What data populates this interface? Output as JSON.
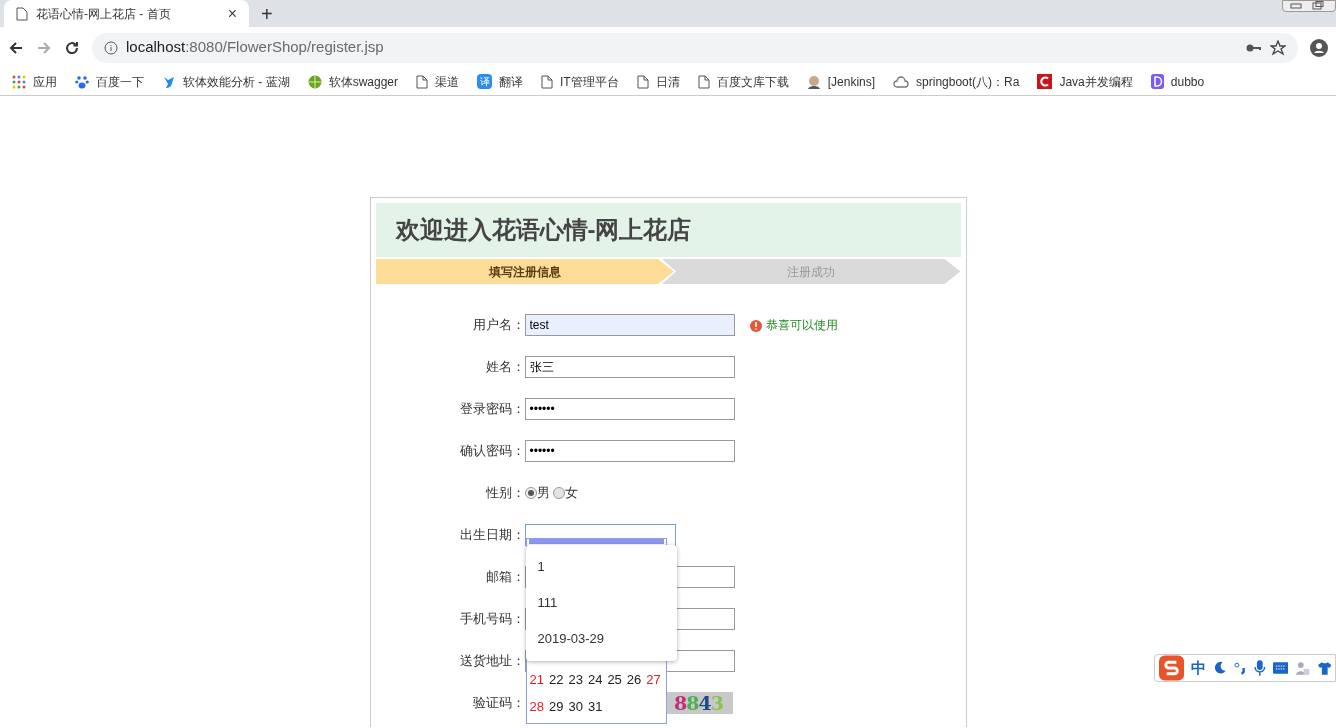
{
  "browser": {
    "tab": {
      "title": "花语心情-网上花店 - 首页",
      "close": "×"
    },
    "new_tab": "+",
    "url": {
      "host": "localhost",
      "path": ":8080/FlowerShop/register.jsp"
    },
    "bookmarks": [
      {
        "kind": "apps",
        "label": "应用"
      },
      {
        "kind": "paw",
        "label": "百度一下"
      },
      {
        "kind": "bird",
        "label": "软体效能分析 - 蓝湖"
      },
      {
        "kind": "globe",
        "label": "软体swagger"
      },
      {
        "kind": "page",
        "label": "渠道"
      },
      {
        "kind": "translate",
        "label": "翻译",
        "glyph": "译"
      },
      {
        "kind": "page",
        "label": "IT管理平台"
      },
      {
        "kind": "page",
        "label": "日清"
      },
      {
        "kind": "page",
        "label": "百度文库下载"
      },
      {
        "kind": "avatar",
        "label": "[Jenkins]"
      },
      {
        "kind": "cloud",
        "label": "springboot(八)：Ra"
      },
      {
        "kind": "c",
        "label": "Java并发编程"
      },
      {
        "kind": "d",
        "label": "dubbo"
      }
    ]
  },
  "page": {
    "title": "欢迎进入花语心情-网上花店",
    "steps": [
      {
        "label": "填写注册信息",
        "selected": true
      },
      {
        "label": "注册成功",
        "selected": false
      }
    ],
    "fields": [
      {
        "kind": "text",
        "label": "用户名：",
        "value": "test",
        "autofilled": true,
        "hint": "恭喜可以使用"
      },
      {
        "kind": "text",
        "label": "姓名：",
        "value": "张三",
        "autofilled": false
      },
      {
        "kind": "password",
        "label": "登录密码：",
        "value": "••••••",
        "autofilled": false
      },
      {
        "kind": "password",
        "label": "确认密码：",
        "value": "••••••",
        "autofilled": false
      },
      {
        "kind": "radio",
        "label": "性别：",
        "options": [
          {
            "label": "男",
            "selected": true
          },
          {
            "label": "女",
            "selected": false
          }
        ]
      },
      {
        "kind": "date",
        "label": "出生日期：",
        "focused": true
      },
      {
        "kind": "text",
        "label": "邮箱：",
        "autofilled": false
      },
      {
        "kind": "text",
        "label": "手机号码：",
        "autofilled": false
      },
      {
        "kind": "text",
        "label": "送货地址：",
        "autofilled": false
      },
      {
        "kind": "captcha",
        "label": "验证码：",
        "captcha": "8843"
      }
    ],
    "suggestions": [
      "1",
      "111",
      "2019-03-29"
    ],
    "calendar_rows": [
      [
        {
          "day": "21",
          "weekend": true
        },
        {
          "day": "22",
          "weekend": false
        },
        {
          "day": "23",
          "weekend": false
        },
        {
          "day": "24",
          "weekend": false
        },
        {
          "day": "25",
          "weekend": false
        },
        {
          "day": "26",
          "weekend": false
        },
        {
          "day": "27",
          "weekend": true
        }
      ],
      [
        {
          "day": "28",
          "weekend": true
        },
        {
          "day": "29",
          "weekend": false
        },
        {
          "day": "30",
          "weekend": false
        },
        {
          "day": "31",
          "weekend": false
        }
      ]
    ]
  },
  "ime": {
    "mode": "中"
  }
}
